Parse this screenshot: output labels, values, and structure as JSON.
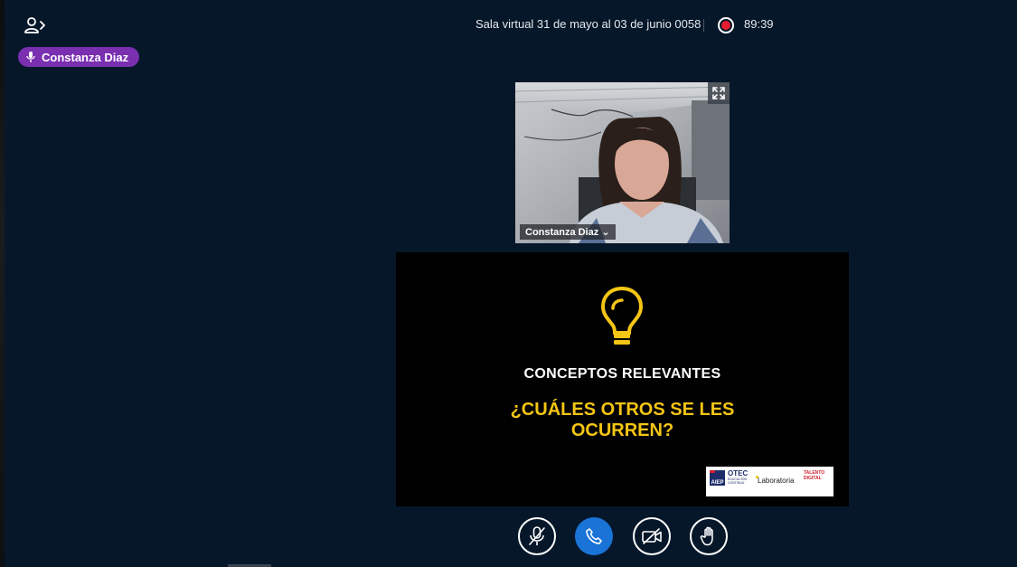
{
  "header": {
    "meeting_title": "Sala virtual 31 de mayo al 03 de junio 0058",
    "recording_time": "89:39",
    "recording_color": "#e41d2f"
  },
  "talking_indicator": {
    "name": "Constanza Diaz",
    "color": "#7a2fb0",
    "icon": "microphone-icon"
  },
  "webcam": {
    "participant_name": "Constanza Diaz",
    "name_suffix": "⌄",
    "fullscreen_icon": "fullscreen-icon"
  },
  "presentation": {
    "heading": "CONCEPTOS RELEVANTES",
    "question": "¿CUÁLES OTROS SE LES OCURREN?",
    "accent_color": "#f4c515",
    "icon": "lightbulb-icon",
    "logos": {
      "aiep": "AIEP",
      "otec": "OTEC",
      "otec_sub": "EDUCACIÓN CONTINUA",
      "laboratoria": "Laboratoria",
      "talento": "TALENTO DIGITAL"
    }
  },
  "controls": {
    "mute_icon": "microphone-muted-icon",
    "leave_icon": "phone-icon",
    "video_icon": "camera-off-icon",
    "raise_hand_icon": "hand-icon",
    "primary_color": "#1a73d6"
  }
}
